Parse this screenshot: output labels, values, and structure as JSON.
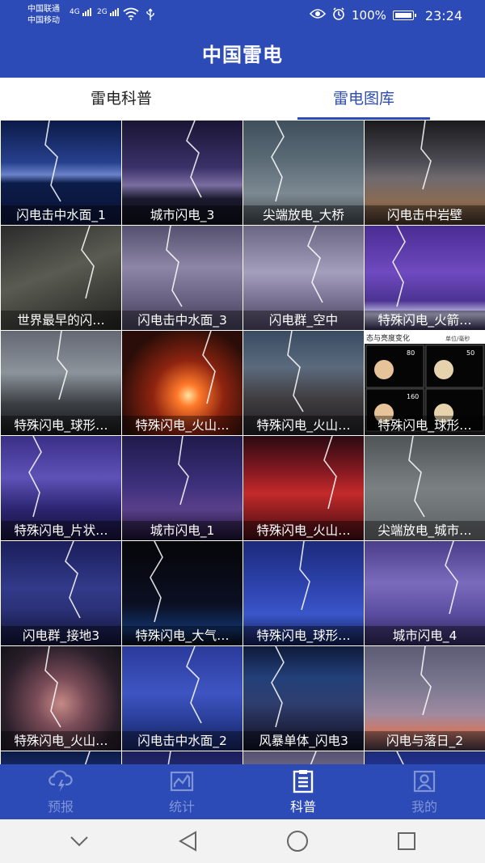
{
  "status_bar": {
    "carrier1": "中国联通",
    "carrier2": "中国移动",
    "net1": "4G",
    "net2": "2G",
    "battery": "100%",
    "time": "23:24"
  },
  "app": {
    "title": "中国雷电"
  },
  "tabs": [
    {
      "label": "雷电科普",
      "active": false
    },
    {
      "label": "雷电图库",
      "active": true
    }
  ],
  "gallery": [
    {
      "caption": "闪电击中水面_1",
      "style": "g-lake"
    },
    {
      "caption": "城市闪电_3",
      "style": "g-city"
    },
    {
      "caption": "尖端放电_大桥",
      "style": "g-bridge"
    },
    {
      "caption": "闪电击中岩壁",
      "style": "g-rock"
    },
    {
      "caption": "世界最早的闪…",
      "style": "g-dark"
    },
    {
      "caption": "闪电击中水面_3",
      "style": "g-lilac"
    },
    {
      "caption": "闪电群_空中",
      "style": "g-lilac2"
    },
    {
      "caption": "特殊闪电_火箭…",
      "style": "g-violet"
    },
    {
      "caption": "特殊闪电_球形…",
      "style": "g-storm"
    },
    {
      "caption": "特殊闪电_火山…",
      "style": "g-volcano"
    },
    {
      "caption": "特殊闪电_火山…",
      "style": "g-volcano2"
    },
    {
      "caption": "特殊闪电_球形…",
      "style": "g-ball"
    },
    {
      "caption": "特殊闪电_片状…",
      "style": "g-sheet"
    },
    {
      "caption": "城市闪电_1",
      "style": "g-tower"
    },
    {
      "caption": "特殊闪电_火山…",
      "style": "g-red"
    },
    {
      "caption": "尖端放电_城市…",
      "style": "g-gray"
    },
    {
      "caption": "闪电群_接地3",
      "style": "g-navy"
    },
    {
      "caption": "特殊闪电_大气…",
      "style": "g-black"
    },
    {
      "caption": "特殊闪电_球形…",
      "style": "g-blue"
    },
    {
      "caption": "城市闪电_4",
      "style": "g-purple"
    },
    {
      "caption": "特殊闪电_火山…",
      "style": "g-cloud"
    },
    {
      "caption": "闪电击中水面_2",
      "style": "g-sea2"
    },
    {
      "caption": "风暴单体_闪电3",
      "style": "g-canyon"
    },
    {
      "caption": "闪电与落日_2",
      "style": "g-sunset"
    },
    {
      "caption": "",
      "style": "g-lake"
    },
    {
      "caption": "",
      "style": "g-navy"
    },
    {
      "caption": "",
      "style": "g-lilac"
    },
    {
      "caption": "",
      "style": "g-blue"
    }
  ],
  "ball_chart": {
    "title": "态与亮度变化",
    "unit": "单位/毫秒",
    "labels": [
      "80",
      "50",
      "160"
    ]
  },
  "bottom_nav": [
    {
      "label": "预报",
      "icon": "cloud-lightning-icon",
      "active": false
    },
    {
      "label": "统计",
      "icon": "chart-icon",
      "active": false
    },
    {
      "label": "科普",
      "icon": "document-list-icon",
      "active": true
    },
    {
      "label": "我的",
      "icon": "user-icon",
      "active": false
    }
  ],
  "colors": {
    "primary": "#2d4bb6",
    "nav_inactive": "#7f95d8",
    "nav_active": "#ffffff"
  }
}
